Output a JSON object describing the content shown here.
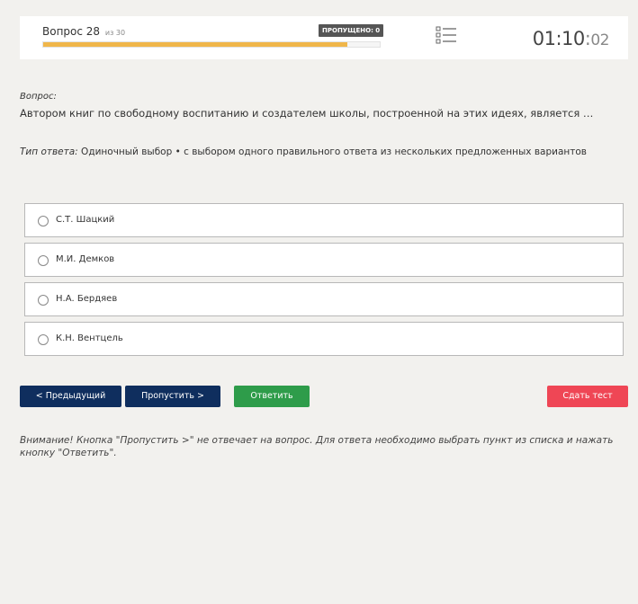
{
  "header": {
    "question_title": "Вопрос 28",
    "question_of": "из 30",
    "skipped_badge": "ПРОПУЩЕНО: 0",
    "progress_fraction": 0.903,
    "timer_hm": "01:10",
    "timer_sep": ":",
    "timer_sec": "02",
    "list_icon": "list-icon"
  },
  "question": {
    "label": "Вопрос:",
    "text": "Автором книг по свободному воспитанию и создателем школы, построенной на этих идеях, является …"
  },
  "answer_type": {
    "label": "Тип ответа:",
    "text": " Одиночный выбор • с выбором одного правильного ответа из нескольких предложенных вариантов"
  },
  "options": [
    {
      "label": "С.Т. Шацкий"
    },
    {
      "label": "М.И. Демков"
    },
    {
      "label": "Н.А. Бердяев"
    },
    {
      "label": "К.Н. Вентцель"
    }
  ],
  "buttons": {
    "prev": "< Предыдущий",
    "skip": "Пропустить >",
    "answer": "Ответить",
    "submit": "Сдать тест"
  },
  "note": "Внимание! Кнопка \"Пропустить >\" не отвечает на вопрос. Для ответа необходимо выбрать пункт из списка и нажать кнопку \"Ответить\".",
  "colors": {
    "background": "#f2f1ee",
    "progress": "#f0b64a",
    "nav_button": "#0f2e5e",
    "answer_button": "#2e9c4a",
    "submit_button": "#ef4655"
  }
}
